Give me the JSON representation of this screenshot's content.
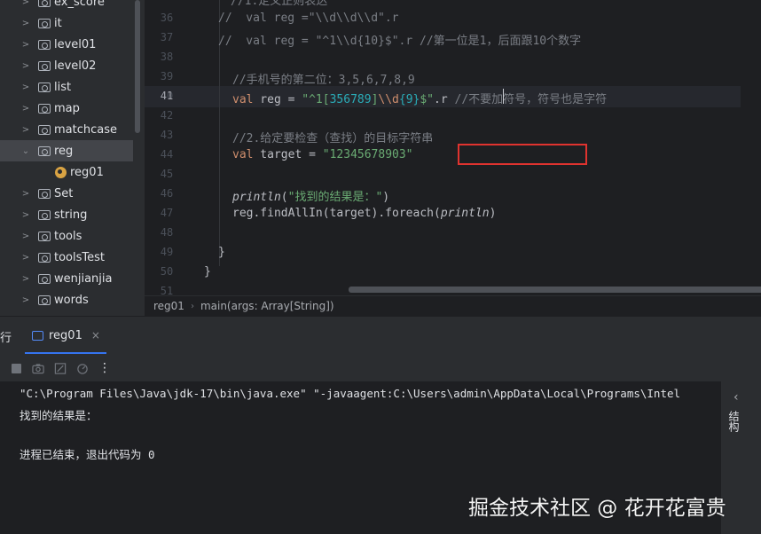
{
  "project_tree": {
    "items": [
      {
        "label": "ex_score",
        "type": "folder"
      },
      {
        "label": "it",
        "type": "folder"
      },
      {
        "label": "level01",
        "type": "folder"
      },
      {
        "label": "level02",
        "type": "folder"
      },
      {
        "label": "list",
        "type": "folder"
      },
      {
        "label": "map",
        "type": "folder"
      },
      {
        "label": "matchcase",
        "type": "folder"
      },
      {
        "label": "reg",
        "type": "folder",
        "expanded": true,
        "selected": true
      },
      {
        "label": "reg01",
        "type": "object"
      },
      {
        "label": "Set",
        "type": "folder"
      },
      {
        "label": "string",
        "type": "folder"
      },
      {
        "label": "tools",
        "type": "folder"
      },
      {
        "label": "toolsTest",
        "type": "folder"
      },
      {
        "label": "wenjianjia",
        "type": "folder"
      },
      {
        "label": "words",
        "type": "folder"
      }
    ]
  },
  "editor": {
    "line_numbers": [
      "36",
      "37",
      "38",
      "39",
      "40",
      "41",
      "42",
      "43",
      "44",
      "45",
      "46",
      "47",
      "48",
      "49",
      "50",
      "51"
    ],
    "current_line": "41",
    "lines": {
      "l36": "//1.定义正则表达",
      "l37a": "//  val reg =\"",
      "l37b": "\\\\d\\\\d\\\\d",
      "l37c": "\".r",
      "l38a": "//  val reg = \"^1",
      "l38b": "\\\\d{10}$",
      "l38c": "\".r //第一位是1，后面跟10个数字",
      "l40": "//手机号的第二位：3,5,6,7,8,9",
      "l41_kw": "val",
      "l41_name": " reg = ",
      "l41_str1": "\"^1[",
      "l41_cls": "356789",
      "l41_str2": "]",
      "l41_esc": "\\\\d",
      "l41_q": "{9}",
      "l41_str3": "$\"",
      "l41_tail": ".r ",
      "l41_cmt": "//不要加符号，符号也是字符",
      "l43": "//2.给定要检查（查找）的目标字符串",
      "l44_kw": "val",
      "l44_name": " target = ",
      "l44_str": "\"12345678903\"",
      "l46_fn": "println",
      "l46_open": "(",
      "l46_str": "\"找到的结果是：\"",
      "l46_close": ")",
      "l47_a": "reg.findAllIn(target).foreach(",
      "l47_fn": "println",
      "l47_b": ")",
      "l49": "}",
      "l50": "}"
    }
  },
  "breadcrumb": {
    "items": [
      "reg01",
      "main(args: Array[String])"
    ]
  },
  "run_window": {
    "title": "行",
    "tab_label": "reg01",
    "tab_close": "×",
    "console_lines": [
      "\"C:\\Program Files\\Java\\jdk-17\\bin\\java.exe\" \"-javaagent:C:\\Users\\admin\\AppData\\Local\\Programs\\Intel",
      "找到的结果是：",
      "",
      "进程已结束，退出代码为 0"
    ],
    "side_label": "结构"
  },
  "watermark": "掘金技术社区 @ 花开花富贵",
  "colors": {
    "editor_bg": "#1e1f22",
    "panel_bg": "#2b2d30",
    "keyword": "#cf8e6d",
    "string": "#6aab73",
    "comment": "#7a7e85",
    "highlight_box": "#e0332f",
    "accent": "#3574f0"
  }
}
